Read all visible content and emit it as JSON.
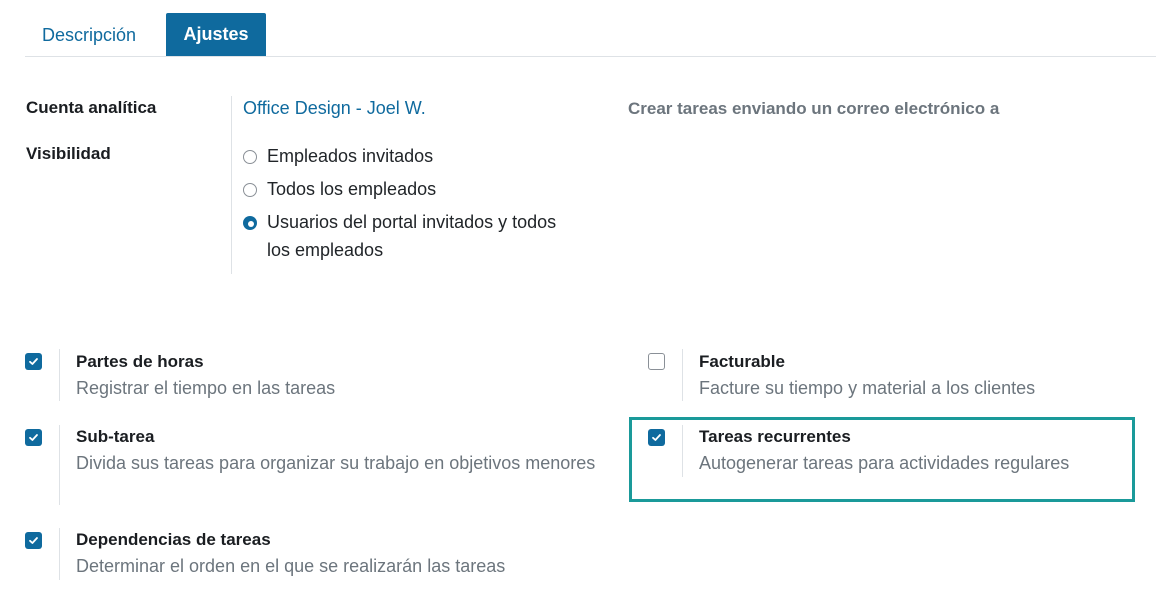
{
  "tabs": [
    {
      "label": "Descripción",
      "active": false
    },
    {
      "label": "Ajustes",
      "active": true
    }
  ],
  "form": {
    "analytic_account": {
      "label": "Cuenta analítica",
      "value": "Office Design - Joel W."
    },
    "visibility": {
      "label": "Visibilidad",
      "options": [
        {
          "label": "Empleados invitados",
          "selected": false
        },
        {
          "label": "Todos los empleados",
          "selected": false
        },
        {
          "label": "Usuarios del portal invitados y todos los empleados",
          "selected": true
        }
      ]
    },
    "email_alias_label": "Crear tareas enviando un correo electrónico a"
  },
  "settings": [
    {
      "title": "Partes de horas",
      "description": "Registrar el tiempo en las tareas",
      "checked": true
    },
    {
      "title": "Facturable",
      "description": "Facture su tiempo y material a los clientes",
      "checked": false
    },
    {
      "title": "Sub-tarea",
      "description": "Divida sus tareas para organizar su trabajo en objetivos menores",
      "checked": true
    },
    {
      "title": "Tareas recurrentes",
      "description": "Autogenerar tareas para actividades regulares",
      "checked": true,
      "highlighted": true
    },
    {
      "title": "Dependencias de tareas",
      "description": "Determinar el orden en el que se realizarán las tareas",
      "checked": true
    }
  ],
  "colors": {
    "accent": "#0f6a9e",
    "highlight_border": "#1a9a9a",
    "muted_text": "#6c757d"
  }
}
